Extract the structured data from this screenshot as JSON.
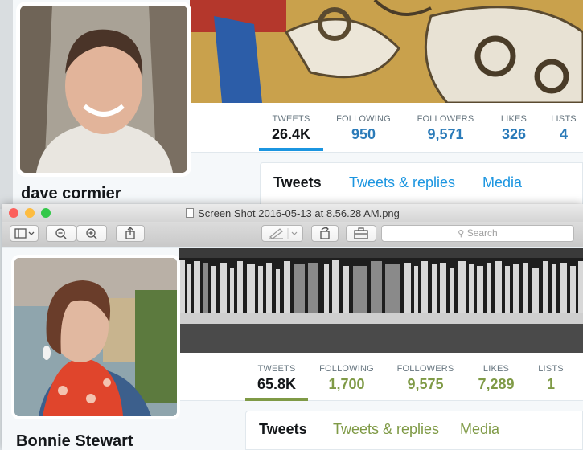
{
  "back_profile": {
    "name": "dave cormier",
    "stats": [
      {
        "label": "TWEETS",
        "value": "26.4K"
      },
      {
        "label": "FOLLOWING",
        "value": "950"
      },
      {
        "label": "FOLLOWERS",
        "value": "9,571"
      },
      {
        "label": "LIKES",
        "value": "326"
      },
      {
        "label": "LISTS",
        "value": "4"
      }
    ],
    "tabs": [
      "Tweets",
      "Tweets & replies",
      "Media"
    ],
    "accent_color": "#1b95e0"
  },
  "preview_window": {
    "title": "Screen Shot 2016-05-13 at 8.56.28 AM.png",
    "search_placeholder": "Search",
    "traffic_lights": [
      "#fc605c",
      "#fdbc40",
      "#34c84a"
    ]
  },
  "front_profile": {
    "name": "Bonnie Stewart",
    "stats": [
      {
        "label": "TWEETS",
        "value": "65.8K"
      },
      {
        "label": "FOLLOWING",
        "value": "1,700"
      },
      {
        "label": "FOLLOWERS",
        "value": "9,575"
      },
      {
        "label": "LIKES",
        "value": "7,289"
      },
      {
        "label": "LISTS",
        "value": "1"
      }
    ],
    "tabs": [
      "Tweets",
      "Tweets & replies",
      "Media"
    ],
    "accent_color": "#7f9a46"
  }
}
